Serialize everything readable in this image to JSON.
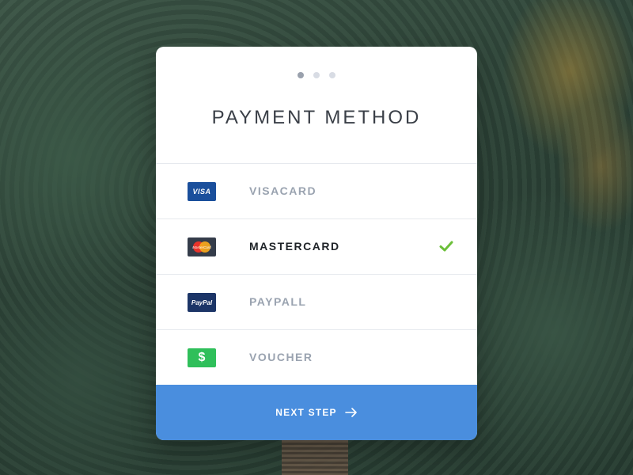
{
  "header": {
    "title": "PAYMENT METHOD",
    "steps": {
      "current": 1,
      "total": 3
    }
  },
  "methods": [
    {
      "label": "VISACARD",
      "logo_text": "VISA",
      "logo_color": "#1a4f9c",
      "selected": false,
      "icon": "visa-logo-icon"
    },
    {
      "label": "MASTERCARD",
      "logo_text": "MasterCard",
      "logo_color": "#343c4a",
      "selected": true,
      "icon": "mastercard-logo-icon"
    },
    {
      "label": "PAYPALL",
      "logo_text": "PayPal",
      "logo_color": "#1c3567",
      "selected": false,
      "icon": "paypal-logo-icon"
    },
    {
      "label": "VOUCHER",
      "logo_text": "$",
      "logo_color": "#2fbf5a",
      "selected": false,
      "icon": "voucher-dollar-icon"
    }
  ],
  "footer": {
    "next_label": "NEXT STEP",
    "icon": "arrow-right-icon"
  },
  "colors": {
    "accent": "#4a8ede",
    "check": "#6cbf3a",
    "muted_text": "#9aa3b0"
  }
}
